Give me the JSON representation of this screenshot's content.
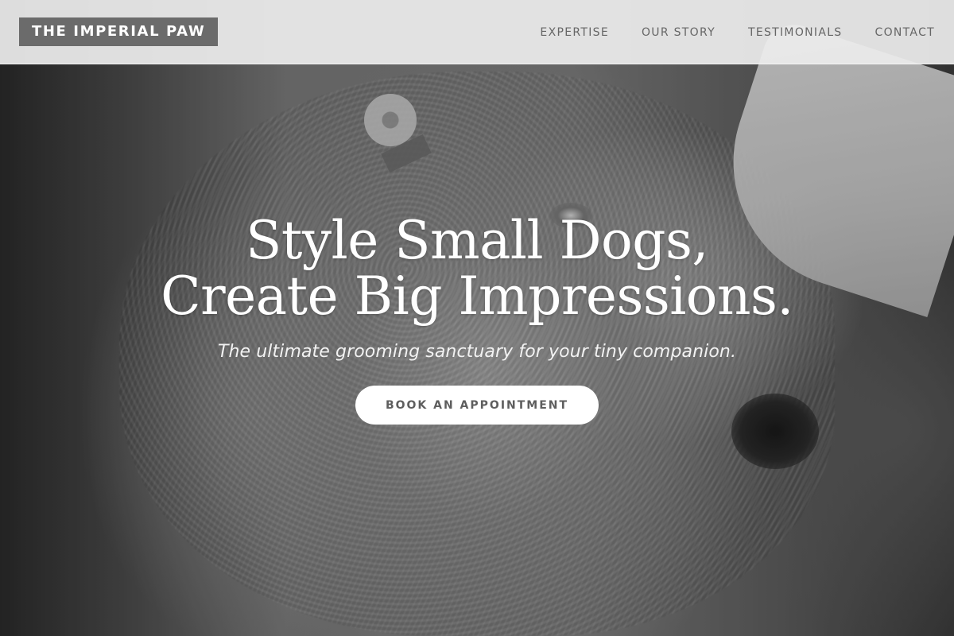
{
  "brand": {
    "name": "THE IMPERIAL PAW"
  },
  "nav": {
    "items": [
      {
        "label": "EXPERTISE"
      },
      {
        "label": "OUR STORY"
      },
      {
        "label": "TESTIMONIALS"
      },
      {
        "label": "CONTACT"
      }
    ]
  },
  "hero": {
    "title_line1": "Style Small Dogs,",
    "title_line2": "Create Big Impressions.",
    "subtitle": "The ultimate grooming sanctuary for your tiny companion.",
    "cta_label": "BOOK AN APPOINTMENT"
  },
  "theme": {
    "navbar_bg": "#ececec",
    "logo_bg": "#6b6b6b",
    "text_on_image": "#ffffff",
    "button_bg": "#ffffff",
    "button_text": "#5e5e5e"
  }
}
